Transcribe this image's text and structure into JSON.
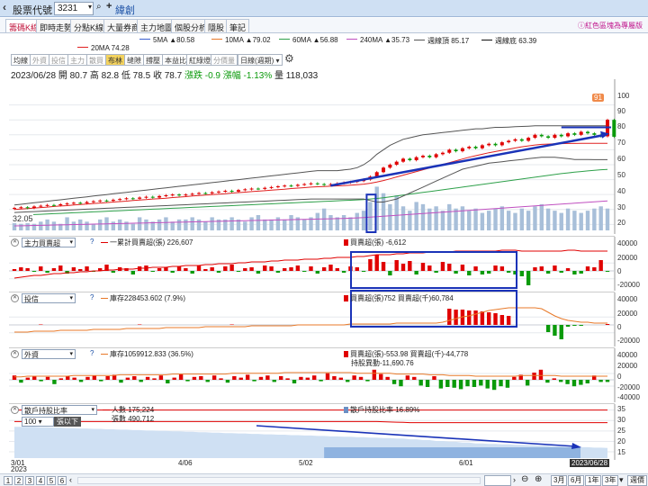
{
  "window": {
    "title": "股票代號",
    "code": "3231",
    "stock_name": "緯創"
  },
  "tabs": [
    {
      "label": "籌碼K線",
      "active": true
    },
    {
      "label": "即時走勢",
      "active": false
    },
    {
      "label": "分點K線",
      "active": false
    },
    {
      "label": "大量券商",
      "active": false
    },
    {
      "label": "主力地圖",
      "active": false
    },
    {
      "label": "個股分析",
      "active": false
    },
    {
      "label": "隱股",
      "active": false
    },
    {
      "label": "筆記",
      "active": false
    }
  ],
  "tabs_note": "ⓘ紅色區塊為專屬版",
  "ma_legend": [
    {
      "label": "5MA ▲80.58",
      "color": "#3a5fd0"
    },
    {
      "label": "10MA ▲79.02",
      "color": "#e87a2a"
    },
    {
      "label": "60MA ▲56.88",
      "color": "#2ea04a"
    },
    {
      "label": "240MA ▲35.73",
      "color": "#c050c0"
    },
    {
      "label": "週線頂 85.17",
      "color": "#555555"
    },
    {
      "label": "週線底 63.39",
      "color": "#111111"
    },
    {
      "label": "20MA 74.28",
      "color": "#e02020"
    }
  ],
  "toolbar": {
    "items": [
      {
        "label": "均線",
        "state": "normal"
      },
      {
        "label": "外資",
        "state": "grey"
      },
      {
        "label": "投信",
        "state": "grey"
      },
      {
        "label": "主力",
        "state": "grey"
      },
      {
        "label": "散買",
        "state": "grey"
      },
      {
        "label": "布林",
        "state": "active"
      },
      {
        "label": "缝隙",
        "state": "normal"
      },
      {
        "label": "撐壓",
        "state": "normal"
      },
      {
        "label": "本益比",
        "state": "normal"
      },
      {
        "label": "紅綠燈",
        "state": "normal"
      },
      {
        "label": "分價量",
        "state": "grey"
      }
    ],
    "period": "日線(週期)"
  },
  "quote": {
    "date": "2023/06/28",
    "open": "開 80.7",
    "high": "高 82.8",
    "low": "低 78.5",
    "close": "收 78.7",
    "change": "漲跌 -0.9",
    "pct": "漲幅 -1.13%",
    "volume": "量 118,033"
  },
  "price_pane": {
    "y_ticks": [
      "100",
      "90",
      "80",
      "70",
      "60",
      "50",
      "40",
      "30",
      "20"
    ],
    "low_label": "32.05",
    "high_label": "91",
    "ymin": 16,
    "ymax": 110,
    "close": [
      31,
      31.5,
      31,
      32,
      32.5,
      33,
      32.8,
      33.5,
      34,
      34.5,
      34.2,
      35,
      35.5,
      36,
      35.8,
      36.5,
      37,
      37.5,
      37.2,
      38,
      38.5,
      38,
      39,
      39.5,
      40,
      39.5,
      40,
      40.5,
      41,
      40.8,
      41.5,
      42,
      42.5,
      42,
      43,
      43.5,
      44,
      43.8,
      44.5,
      45,
      45.5,
      46,
      45.8,
      46.5,
      47,
      47.5,
      47,
      46.5,
      47,
      47.5,
      48,
      48.5,
      49,
      50,
      52,
      55,
      58,
      60,
      62,
      64,
      63,
      65,
      66,
      65,
      67,
      68,
      70,
      69,
      71,
      72,
      71,
      73,
      74,
      73,
      75,
      76,
      77,
      76,
      78,
      80,
      79,
      78,
      80,
      79,
      81,
      80,
      82,
      81,
      80,
      79,
      90,
      78.7
    ],
    "ma20": [
      30,
      30.3,
      30.6,
      31,
      31.3,
      31.6,
      32,
      32.3,
      32.6,
      33,
      33.3,
      33.6,
      34,
      34.3,
      34.6,
      35,
      35.3,
      35.6,
      36,
      36.3,
      36.6,
      37,
      37.3,
      37.6,
      38,
      38.3,
      38.6,
      39,
      39.3,
      39.6,
      40,
      40.3,
      40.6,
      41,
      41.3,
      41.6,
      42,
      42.3,
      42.6,
      43,
      43.3,
      43.6,
      44,
      44.3,
      44.6,
      45,
      45.2,
      45.4,
      45.6,
      45.8,
      46,
      46.3,
      46.6,
      47,
      47.6,
      48.4,
      49.4,
      50.5,
      51.8,
      53,
      54.2,
      55.4,
      56.6,
      57.8,
      59,
      60.2,
      61.4,
      62.6,
      63.8,
      65,
      66,
      67,
      68,
      68.8,
      69.6,
      70.4,
      71.2,
      72,
      72.6,
      73.2,
      73.6,
      73.8,
      74,
      74.1,
      74.2,
      74.2,
      74.3,
      74.3,
      74.3,
      74.28,
      74.28
    ],
    "ma60": [
      26,
      26.2,
      26.4,
      26.6,
      26.8,
      27,
      27.2,
      27.4,
      27.6,
      27.8,
      28,
      28.2,
      28.4,
      28.6,
      28.8,
      29,
      29.2,
      29.4,
      29.6,
      29.8,
      30,
      30.2,
      30.4,
      30.6,
      30.8,
      31,
      31.2,
      31.4,
      31.6,
      31.8,
      32,
      32.2,
      32.4,
      32.6,
      32.8,
      33,
      33.2,
      33.4,
      33.6,
      33.8,
      34,
      34.2,
      34.4,
      34.6,
      34.8,
      35,
      35.2,
      35.4,
      35.6,
      35.8,
      36,
      36.2,
      36.4,
      36.6,
      37,
      37.4,
      37.9,
      38.4,
      39,
      39.6,
      40.2,
      40.8,
      41.4,
      42,
      42.6,
      43.2,
      43.8,
      44.4,
      45,
      45.6,
      46.2,
      46.8,
      47.4,
      48,
      48.6,
      49.2,
      49.8,
      50.4,
      51,
      51.6,
      52.2,
      52.8,
      53.4,
      54,
      54.5,
      55,
      55.4,
      55.8,
      56.2,
      56.6,
      56.88
    ],
    "ma240": [
      19,
      19.1,
      19.2,
      19.3,
      19.4,
      19.5,
      19.6,
      19.7,
      19.8,
      19.9,
      20,
      20.1,
      20.2,
      20.3,
      20.4,
      20.5,
      20.6,
      20.7,
      20.8,
      20.9,
      21,
      21.1,
      21.2,
      21.3,
      21.4,
      21.5,
      21.6,
      21.7,
      21.8,
      21.9,
      22,
      22.1,
      22.2,
      22.3,
      22.4,
      22.5,
      22.6,
      22.7,
      22.8,
      22.9,
      23,
      23.1,
      23.2,
      23.3,
      23.4,
      23.5,
      23.6,
      23.7,
      23.8,
      23.9,
      24,
      24.2,
      24.4,
      24.6,
      24.9,
      25.2,
      25.5,
      25.8,
      26.1,
      26.4,
      26.7,
      27,
      27.3,
      27.6,
      27.9,
      28.2,
      28.5,
      28.8,
      29.1,
      29.4,
      29.7,
      30,
      30.3,
      30.6,
      30.9,
      31.2,
      31.5,
      31.8,
      32.1,
      32.4,
      32.7,
      33,
      33.3,
      33.6,
      33.9,
      34.2,
      34.5,
      34.8,
      35.1,
      35.4,
      35.73
    ],
    "upper": [
      33,
      33.5,
      34,
      34.5,
      35,
      35.5,
      36,
      36.5,
      37,
      37.5,
      38,
      38.5,
      39,
      39.5,
      40,
      40.5,
      41,
      41.5,
      42,
      42.5,
      43,
      43.5,
      44,
      44.5,
      45,
      45.5,
      46,
      46.5,
      47,
      47.5,
      48,
      48.5,
      49,
      49.5,
      50,
      50.5,
      51,
      51.5,
      52,
      52.5,
      53,
      53.5,
      54,
      54.5,
      55,
      55.5,
      56,
      56,
      56,
      56,
      56.5,
      57,
      58,
      60,
      63,
      67,
      70,
      73,
      75,
      77,
      78,
      79,
      80,
      80.5,
      81,
      81.5,
      82,
      82.5,
      83,
      83.5,
      84,
      84,
      84.5,
      85,
      85,
      85.2,
      85.4,
      85.6,
      85.8,
      86,
      86,
      86,
      86,
      86,
      86,
      86,
      86,
      86,
      86,
      86,
      86
    ],
    "lower": [
      28,
      28.2,
      28.4,
      28.6,
      28.8,
      29,
      29.2,
      29.4,
      29.6,
      29.8,
      30,
      30.2,
      30.4,
      30.6,
      30.8,
      31,
      31.2,
      31.4,
      31.6,
      31.8,
      32,
      32.2,
      32.4,
      32.6,
      32.8,
      33,
      33.2,
      33.4,
      33.6,
      33.8,
      34,
      34.2,
      34.4,
      34.6,
      34.8,
      35,
      35.2,
      35.4,
      35.6,
      35.8,
      36,
      36.2,
      36.4,
      36.6,
      36.8,
      37,
      37,
      37,
      37,
      37,
      37,
      37,
      37,
      37,
      36,
      35,
      35,
      36,
      37,
      39,
      41,
      43,
      45,
      47,
      49,
      51,
      53,
      55,
      57,
      58,
      59,
      60,
      61,
      61.5,
      62,
      62.5,
      63,
      63.5,
      64,
      64.5,
      65,
      65,
      65,
      64.5,
      64,
      63.5,
      63.5,
      63.4,
      63.39,
      63.39,
      63.39
    ],
    "volume": [
      4,
      3,
      5,
      3,
      4,
      5,
      4,
      3,
      6,
      4,
      5,
      4,
      3,
      5,
      6,
      4,
      5,
      4,
      3,
      6,
      5,
      4,
      5,
      6,
      4,
      5,
      5,
      6,
      5,
      4,
      6,
      5,
      5,
      6,
      5,
      4,
      6,
      7,
      5,
      5,
      6,
      5,
      7,
      6,
      5,
      6,
      8,
      10,
      7,
      6,
      7,
      6,
      8,
      9,
      13,
      20,
      17,
      12,
      16,
      11,
      9,
      13,
      12,
      10,
      11,
      9,
      12,
      10,
      11,
      9,
      10,
      8,
      9,
      10,
      11,
      9,
      8,
      10,
      9,
      11,
      12,
      10,
      9,
      8,
      10,
      9,
      8,
      9,
      10,
      11,
      10
    ],
    "volume_max": 28
  },
  "pane_main": {
    "select": "主力買賣超",
    "legend_line": "一累計買賣超(張) 226,607",
    "legend_bar": "買賣超(張) -6,612",
    "y_ticks": [
      "40000",
      "20000",
      "0",
      "-20000"
    ],
    "bars": [
      2,
      4,
      3,
      -1,
      5,
      -2,
      3,
      6,
      -3,
      4,
      2,
      5,
      -1,
      3,
      7,
      -2,
      4,
      3,
      -4,
      5,
      6,
      -1,
      3,
      4,
      -2,
      5,
      3,
      -3,
      6,
      2,
      4,
      -2,
      5,
      7,
      -1,
      3,
      4,
      -3,
      6,
      5,
      -2,
      3,
      4,
      6,
      -1,
      5,
      -3,
      4,
      7,
      3,
      -2,
      5,
      4,
      -1,
      13,
      18,
      10,
      -5,
      12,
      8,
      11,
      -4,
      9,
      6,
      -2,
      10,
      8,
      -3,
      7,
      -5,
      5,
      -4,
      -3,
      6,
      5,
      -2,
      -4,
      -6,
      -16,
      4,
      5,
      -3,
      6,
      -2,
      3,
      -4,
      -3,
      5,
      4,
      12,
      -1
    ],
    "bars_max": 45000,
    "line": [
      -8,
      -7,
      -6,
      -5,
      -5,
      -4,
      -3,
      -3,
      -2,
      -2,
      -1,
      -1,
      0,
      0,
      1,
      1,
      2,
      2,
      2,
      3,
      3,
      4,
      4,
      4,
      5,
      5,
      6,
      6,
      6,
      7,
      7,
      8,
      8,
      8,
      9,
      9,
      10,
      10,
      10,
      11,
      11,
      12,
      12,
      12,
      13,
      13,
      13,
      14,
      14,
      15,
      15,
      15,
      16,
      16,
      17,
      18,
      18,
      18,
      19,
      19,
      20,
      20,
      20,
      21,
      21,
      21,
      21,
      22,
      22,
      22,
      22,
      22,
      22,
      22,
      23,
      23,
      23,
      22,
      22,
      22,
      22,
      22,
      22,
      22,
      23,
      23,
      22,
      22,
      22,
      22,
      22
    ]
  },
  "pane_trust": {
    "select": "投信",
    "legend_line": "庫存228453.602 (7.9%)",
    "legend_bar": "買賣超(張)752 買賣超(千)60,784",
    "y_ticks": [
      "40000",
      "20000",
      "0",
      "-20000"
    ],
    "bars": [
      0,
      0,
      0,
      0,
      0.5,
      0,
      0,
      0,
      0,
      0,
      0,
      0,
      0,
      0,
      0,
      0,
      0,
      0,
      0,
      0.5,
      0,
      0,
      0,
      0,
      0,
      0,
      0,
      0,
      0,
      0,
      0,
      0,
      0,
      0.5,
      0,
      0,
      0,
      0,
      0,
      0,
      0,
      0,
      0,
      0,
      0,
      0,
      0,
      0,
      0,
      0,
      0,
      0,
      0,
      0,
      0,
      0,
      0,
      0,
      0,
      0,
      0,
      0,
      0,
      0,
      0,
      0,
      18,
      17,
      17,
      16,
      16,
      15,
      14,
      13,
      11,
      10,
      0,
      0,
      0,
      0,
      0,
      -8,
      -12,
      -16,
      -2,
      -1,
      -1,
      0,
      0,
      0,
      1
    ],
    "bars_max": 45000,
    "line": [
      -8,
      -8,
      -8,
      -7,
      -7,
      -7,
      -7,
      -6,
      -6,
      -6,
      -6,
      -6,
      -5,
      -5,
      -5,
      -5,
      -5,
      -4,
      -4,
      -4,
      -4,
      -4,
      -4,
      -3,
      -3,
      -3,
      -3,
      -3,
      -3,
      -2,
      -2,
      -2,
      -2,
      -2,
      -2,
      -2,
      -1,
      -1,
      -1,
      -1,
      -1,
      -1,
      -1,
      0,
      0,
      0,
      0,
      0,
      0,
      0,
      0,
      1,
      1,
      1,
      1,
      1,
      1,
      1,
      2,
      2,
      2,
      2,
      2,
      2,
      2,
      3,
      5,
      7,
      9,
      10,
      12,
      14,
      16,
      17,
      18,
      19,
      19,
      19,
      19,
      19,
      18,
      14,
      10,
      7,
      5,
      4,
      3,
      3,
      2,
      2,
      2
    ]
  },
  "pane_foreign": {
    "select": "外資",
    "legend_line": "庫存1059912.833 (36.5%)",
    "legend_bar": "買賣超(張)-553.98 買賣超(千)-44,778",
    "legend_bar2": "持股異動-11,690.76",
    "y_ticks": [
      "40000",
      "20000",
      "0",
      "-20000",
      "-40000"
    ],
    "bars": [
      6,
      -4,
      3,
      5,
      -2,
      4,
      -6,
      2,
      5,
      3,
      -3,
      4,
      6,
      -2,
      5,
      7,
      -4,
      3,
      5,
      -3,
      4,
      2,
      6,
      -5,
      3,
      8,
      -2,
      4,
      5,
      -3,
      6,
      2,
      -4,
      5,
      3,
      7,
      -2,
      4,
      6,
      -3,
      5,
      2,
      -5,
      4,
      3,
      6,
      -2,
      9,
      5,
      3,
      -3,
      6,
      4,
      -2,
      14,
      8,
      4,
      -6,
      -9,
      6,
      4,
      -8,
      -10,
      5,
      -12,
      -10,
      -11,
      -13,
      -9,
      -10,
      -8,
      -12,
      -14,
      -9,
      -11,
      4,
      7,
      -8,
      10,
      14,
      -4,
      2,
      -3,
      -6,
      -9,
      -7,
      -5,
      6,
      -3,
      -3
    ],
    "bars_max": 48000,
    "line": [
      4,
      4,
      5,
      5,
      5,
      5,
      5,
      5,
      5,
      6,
      6,
      6,
      6,
      6,
      6,
      6,
      7,
      7,
      7,
      7,
      7,
      7,
      7,
      7,
      8,
      8,
      8,
      8,
      8,
      8,
      8,
      8,
      8,
      9,
      9,
      9,
      9,
      9,
      9,
      9,
      9,
      10,
      10,
      10,
      10,
      10,
      10,
      10,
      10,
      10,
      10,
      10,
      9,
      9,
      9,
      9,
      9,
      9,
      8,
      8,
      8,
      8,
      8,
      7,
      7,
      7,
      6,
      6,
      6,
      6,
      5,
      5,
      5,
      5,
      5,
      5,
      5,
      6,
      6,
      6,
      6,
      6,
      6,
      5,
      5,
      5,
      5,
      5,
      5,
      5,
      5
    ]
  },
  "pane_holders": {
    "select": "散戶持股比率",
    "filter_value": "100",
    "filter_unit": "張以下",
    "legend_line": "人數 175,224",
    "legend_line2": "張數 490,712",
    "legend_area": "散戶持股比率 16.89%",
    "y_ticks": [
      "35",
      "30",
      "25",
      "20",
      "15"
    ],
    "ymin": 12,
    "ymax": 37,
    "area": [
      27,
      27,
      27,
      27,
      26.8,
      26.8,
      26.6,
      26.6,
      26.4,
      26.4,
      26.2,
      26.2,
      26,
      26,
      25.8,
      25.8,
      25.6,
      25.6,
      25.4,
      25.4,
      25.2,
      25.2,
      25,
      25,
      24.8,
      24.8,
      24.6,
      24.6,
      24.4,
      24.4,
      24.2,
      24.2,
      24,
      24,
      23.8,
      23.8,
      23.6,
      23.6,
      23.4,
      23.4,
      23.2,
      23.2,
      23,
      23,
      22.8,
      22.8,
      22.6,
      22.6,
      22.4,
      22.4,
      22.2,
      22.2,
      22,
      22,
      21.8,
      21.8,
      21.6,
      21.6,
      21.4,
      21.4,
      21,
      21,
      20.6,
      20.6,
      20.2,
      20.2,
      19.8,
      19.8,
      19.4,
      19.4,
      19,
      19,
      18.8,
      18.8,
      18.6,
      18.6,
      18.4,
      18.4,
      18.2,
      18.2,
      18,
      18,
      17.6,
      17.6,
      17.4,
      17.4,
      17.2,
      17.2,
      17,
      17,
      16.89
    ],
    "line1": [
      35,
      35,
      35,
      35,
      35,
      35,
      35,
      35,
      35,
      35,
      35,
      35,
      35,
      35,
      35,
      35,
      35,
      35,
      35,
      35,
      35,
      35,
      35,
      35,
      35,
      35,
      35,
      35,
      35,
      35,
      35,
      35,
      35,
      35,
      35,
      35,
      35,
      35,
      35,
      35,
      35,
      35,
      35,
      35,
      35,
      35,
      35,
      35,
      35,
      35,
      35,
      35,
      35,
      35,
      35,
      35,
      35,
      35,
      35,
      35,
      35,
      35,
      35,
      35,
      35,
      35,
      35,
      35,
      35,
      35,
      35,
      35,
      35,
      35,
      35,
      35,
      35,
      35,
      35,
      35,
      35,
      35,
      35,
      35,
      35,
      35,
      35,
      35,
      35,
      35,
      35
    ],
    "line2": [
      29.5,
      29.5,
      29.5,
      29.5,
      29.5,
      29.5,
      29.5,
      29.5,
      29.5,
      29.5,
      29.5,
      29.5,
      29.5,
      29.5,
      29.5,
      29.5,
      29.5,
      29.5,
      29.5,
      29.5,
      29.5,
      29.5,
      29.5,
      29.5,
      29.5,
      29.5,
      29.5,
      29.5,
      29.5,
      29.5,
      29.5,
      29.5,
      29.5,
      29.5,
      29.5,
      29.5,
      29.5,
      29.5,
      29.5,
      29.5,
      29.5,
      29.5,
      29.5,
      29.5,
      29.5,
      29.5,
      29.5,
      29.5,
      29.5,
      29.5,
      29.5,
      29.5,
      29.5,
      29.5,
      29.5,
      29.5,
      29.4,
      29.3,
      29.2,
      29.1,
      29,
      29,
      29,
      29,
      29,
      29,
      29,
      29,
      29,
      29,
      29,
      29,
      29,
      29,
      29,
      29,
      29,
      29,
      29,
      29,
      29,
      29,
      29,
      29,
      29,
      29,
      29,
      29,
      29,
      29,
      29
    ]
  },
  "x_axis": {
    "labels": [
      {
        "text": "3/01",
        "sub": "2023",
        "index": 0
      },
      {
        "text": "4/06",
        "sub": "",
        "index": 23
      },
      {
        "text": "5/02",
        "sub": "",
        "index": 40
      },
      {
        "text": "6/01",
        "sub": "",
        "index": 64
      },
      {
        "text": "2023/06/28",
        "sub": "",
        "index": 90
      }
    ]
  },
  "footer": {
    "pages": [
      "1",
      "2",
      "3",
      "4",
      "5",
      "6"
    ],
    "ranges": [
      "3月",
      "6月",
      "1年",
      "3年"
    ],
    "more": "▾",
    "extra": "週價"
  },
  "colors": {
    "up": "#e00000",
    "down": "#0a9a0a",
    "volume": "#a8bfd9",
    "highlight": "#1a33b8"
  }
}
